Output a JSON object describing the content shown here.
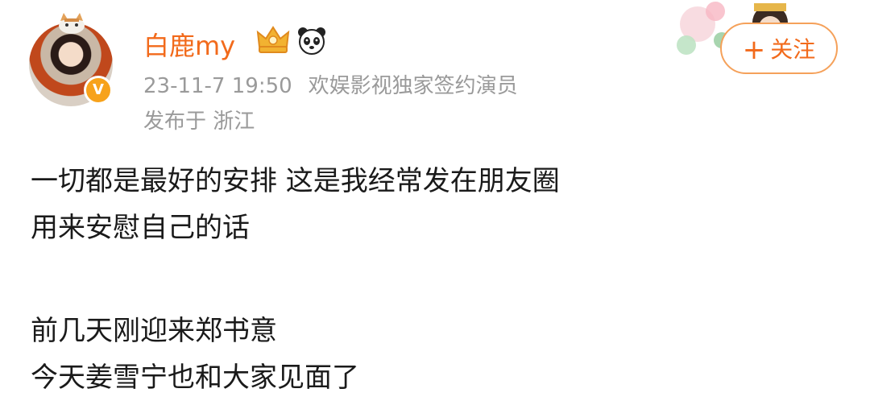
{
  "post": {
    "author": "白鹿my",
    "timestamp": "23-11-7 19:50",
    "source": "欢娱影视独家签约演员",
    "location": "发布于 浙江",
    "follow_button": "关注",
    "follow_plus": "+",
    "verified_mark": "V",
    "badges": [
      "crown-badge-icon",
      "panda-badge-icon"
    ],
    "paragraphs": [
      [
        "一切都是最好的安排 这是我经常发在朋友圈",
        "用来安慰自己的话"
      ],
      [
        "前几天刚迎来郑书意",
        "今天姜雪宁也和大家见面了"
      ]
    ]
  },
  "colors": {
    "username": "#f26a1b",
    "meta": "#9a9a9a",
    "follow_border": "#f5a15a",
    "verified": "#f7a21b",
    "text": "#1a1a1a"
  }
}
